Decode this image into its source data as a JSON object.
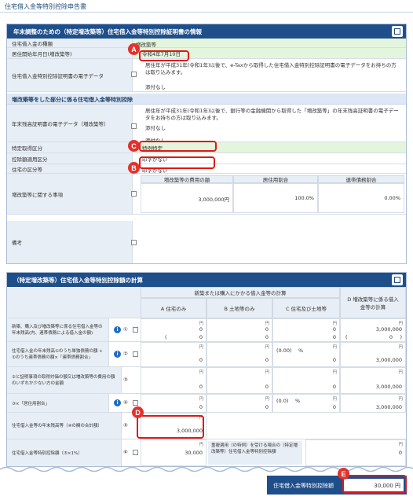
{
  "page_title": "住宅借入金等特別控除申告書",
  "cert_panel": {
    "title": "年末調整のための（特定増改築等）住宅借入金等特別控除証明書の情報",
    "rows": {
      "loan_type": {
        "label": "住宅借入金の種類",
        "value": "増改築等"
      },
      "move_in_date": {
        "label": "居住開始年月日(増改築等)",
        "value": "令和4年7月10日"
      },
      "e_data": {
        "label": "住宅借入金特別控除証明書の電子データ",
        "text": "居住年が平成31年(令和1年)以後で、e-Taxから取得した住宅借入金特別控除証明書の電子データをお持ちの方は取り込みます。",
        "status": "添付なし"
      }
    },
    "section2": "増改築等をした部分に係る住宅借入金等特別控除",
    "rows2": {
      "balance_cert": {
        "label": "年末残高証明書の電子データ（増改築等）",
        "text": "居住年が平成31年(令和1年)以後で、銀行等の金融機関から取得した「増改築等」の年末残高証明書の電子データをお持ちの方は取り込みます。",
        "status1": "添付なし",
        "status2": "添付なし"
      },
      "specific_acq": {
        "label": "特定取得区分",
        "value": "特例特定"
      },
      "deduction_limit": {
        "label": "控除額適用区分",
        "value": "印字がない"
      },
      "housing_type": {
        "label": "住宅の区分等",
        "value": "印字がない"
      },
      "reno_matters": {
        "label": "増改築等に関する事項",
        "col1": "増改築等の費用の額",
        "col2": "居住用割合",
        "col3": "連帯債務割合",
        "v1": "3,000,000円",
        "v2": "100.0%",
        "v3": "0.00%"
      },
      "remarks": {
        "label": "備考"
      }
    }
  },
  "calc_panel": {
    "title": "（特定増改築等）住宅借入金等特別控除額の計算",
    "group_header": "新築または購入にかかる借入金等の計算",
    "col_a": "A 住宅のみ",
    "col_b": "B 土地等のみ",
    "col_c": "C 住宅及び土地等",
    "col_d": "D 増改築等に係る借入金等の計算",
    "unit": "円",
    "rows": [
      {
        "label": "新築、購入及び増改築等に係る住宅借入金等の年末残高(内、連帯債務による借入金の額)",
        "no": "①",
        "a1": "0",
        "a2": "0",
        "b1": "0",
        "b2": "0",
        "c1": "0",
        "c2": "0",
        "d1": "3,000,000",
        "d2": "0",
        "pa": "(",
        "pb": ")"
      },
      {
        "label": "住宅借入金の年末残高①のうち単独債務の額 + ①のうち連帯債務の額×「連帯債務割合」",
        "no": "②",
        "a1": "0",
        "b1": "0",
        "c_pct": "(0.00)",
        "pct": "%",
        "c1": "0",
        "d1": "3,000,000"
      },
      {
        "label": "②と証明事項の取得対価の額又は増改築等の費用の額のいずれか少ない方の金額",
        "no": "③",
        "a1": "0",
        "b1": "0",
        "c1": "0",
        "d1": "3,000,000"
      },
      {
        "label": "③×「居住用割合」",
        "no": "④",
        "a1": "0",
        "b1": "0",
        "c_pct": "(0.0)",
        "pct": "%",
        "c1": "0",
        "d1": "3,000,000"
      },
      {
        "label": "住宅借入金等の年末残高等（④の欄の合計額）",
        "no": "⑤",
        "a1": "3,000,000"
      },
      {
        "label": "住宅借入金等特別控除額（⑤×1%）",
        "no": "⑥",
        "a1": "30,000",
        "note": "重複適用（の特例）を受ける場合の（特定増改築等）住宅借入金等特別控除額",
        "note_v": "0"
      }
    ]
  },
  "footer": {
    "label": "住宅借入金等特別控除額",
    "value": "30,000 円"
  },
  "markers": {
    "a": "A",
    "b": "B",
    "c": "C",
    "d": "D",
    "e": "E"
  }
}
